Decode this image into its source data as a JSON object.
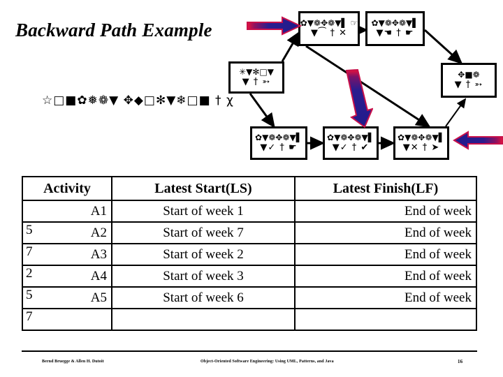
{
  "slide": {
    "title": "Backward Path Example",
    "symbol_subtitle": "☆□■✿❅❁▼ ✥◆□✻▼❄□■ † χ"
  },
  "diagram": {
    "nodes": [
      {
        "id": "node-top-a",
        "line1": "✿▼❁✥❁▼▌ ☞",
        "line2": "▼⁀ † ✕"
      },
      {
        "id": "node-top-b",
        "line1": "✿▼❁✥❁▼▌",
        "line2": "▼☚ † ☛"
      },
      {
        "id": "node-left",
        "line1": "✳▼✻□▼",
        "line2": "▼ † ➳"
      },
      {
        "id": "node-right",
        "line1": "✥■❁",
        "line2": "▼ † ➳"
      },
      {
        "id": "node-bot-a",
        "line1": "✿▼❁✥❁▼▌",
        "line2": "▼✓ † ☛"
      },
      {
        "id": "node-bot-b",
        "line1": "✿▼❁✥❁▼▌",
        "line2": "▼✓ † ✔"
      },
      {
        "id": "node-bot-c",
        "line1": "✿▼❁✥❁▼▌",
        "line2": "▼✕ † ➤"
      }
    ],
    "arrows": {
      "color_start": "#E8123A",
      "color_end": "#211B8C",
      "outline": "#C8104A"
    },
    "connector_color": "#000000"
  },
  "table": {
    "columns": [
      "Activity",
      "Latest Start(LS)",
      "Latest Finish(LF)"
    ],
    "rows": [
      {
        "spill": "",
        "activity": "A1",
        "ls": "Start of week 1",
        "lf": "End of week"
      },
      {
        "spill": "5",
        "activity": "A2",
        "ls": "Start of week 7",
        "lf": "End of week"
      },
      {
        "spill": "7",
        "activity": "A3",
        "ls": "Start of week 2",
        "lf": "End of week"
      },
      {
        "spill": "2",
        "activity": "A4",
        "ls": "Start of week 3",
        "lf": "End of week"
      },
      {
        "spill": "5",
        "activity": "A5",
        "ls": "Start of week 6",
        "lf": "End of week"
      },
      {
        "spill": "7",
        "activity": "",
        "ls": "",
        "lf": ""
      }
    ]
  },
  "footer": {
    "left": "Bernd Bruegge & Allen H. Dutoit",
    "center": "Object-Oriented Software Engineering: Using UML, Patterns, and Java",
    "page": "16"
  }
}
